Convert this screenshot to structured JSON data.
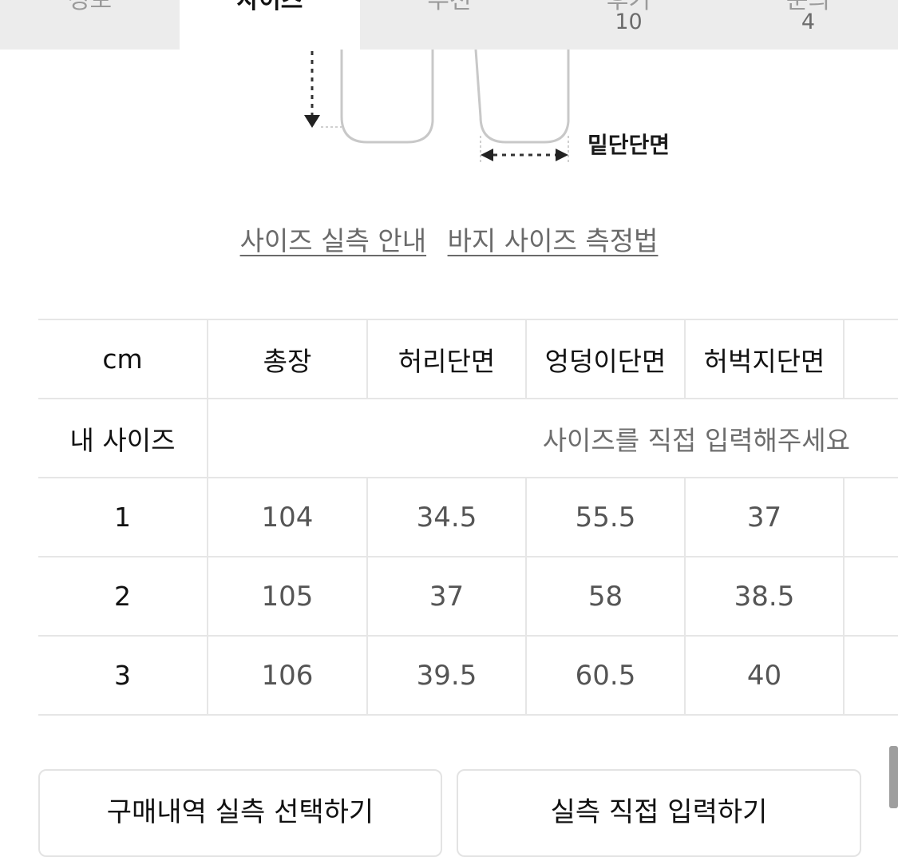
{
  "tabs": [
    {
      "label": "정보",
      "count": ""
    },
    {
      "label": "사이즈",
      "count": ""
    },
    {
      "label": "추천",
      "count": ""
    },
    {
      "label": "후기",
      "count": "10"
    },
    {
      "label": "문의",
      "count": "4"
    }
  ],
  "active_tab": "사이즈",
  "diagram": {
    "hem_label": "밑단단면"
  },
  "guide_links": {
    "actual_size": "사이즈 실측 안내",
    "how_to_measure": "바지 사이즈 측정법"
  },
  "size_table": {
    "headers": [
      "cm",
      "총장",
      "허리단면",
      "엉덩이단면",
      "허벅지단면"
    ],
    "my_size_label": "내 사이즈",
    "my_size_placeholder": "사이즈를 직접 입력해주세요",
    "rows": [
      {
        "size": "1",
        "values": [
          "104",
          "34.5",
          "55.5",
          "37"
        ]
      },
      {
        "size": "2",
        "values": [
          "105",
          "37",
          "58",
          "38.5"
        ]
      },
      {
        "size": "3",
        "values": [
          "106",
          "39.5",
          "60.5",
          "40"
        ]
      }
    ]
  },
  "buttons": {
    "select_purchase": "구매내역 실측 선택하기",
    "direct_input": "실측 직접 입력하기"
  }
}
